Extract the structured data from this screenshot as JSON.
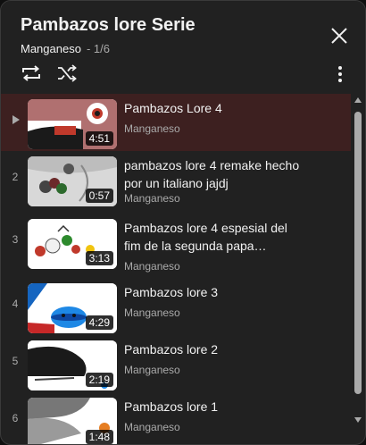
{
  "header": {
    "title": "Pambazos lore Serie",
    "channel": "Manganeso",
    "position": "- 1/6"
  },
  "icons": {
    "close": "close-icon",
    "loop": "loop-icon",
    "shuffle": "shuffle-icon",
    "menu": "more-vertical-icon",
    "now_playing": "play-indicator-icon"
  },
  "colors": {
    "panel_bg": "#212121",
    "active_row": "#3d2020",
    "text_primary": "#f1f1f1",
    "text_secondary": "#aaaaaa"
  },
  "playlist": {
    "items": [
      {
        "index": "",
        "playing": true,
        "title": "Pambazos Lore 4",
        "channel": "Manganeso",
        "duration": "4:51"
      },
      {
        "index": "2",
        "playing": false,
        "title": "pambazos lore 4 remake hecho por un italiano jajdj",
        "channel": "Manganeso",
        "duration": "0:57"
      },
      {
        "index": "3",
        "playing": false,
        "title": "Pambazos lore 4 espesial del fim de la segunda papa…",
        "channel": "Manganeso",
        "duration": "3:13"
      },
      {
        "index": "4",
        "playing": false,
        "title": "Pambazos lore 3",
        "channel": "Manganeso",
        "duration": "4:29"
      },
      {
        "index": "5",
        "playing": false,
        "title": "Pambazos lore 2",
        "channel": "Manganeso",
        "duration": "2:19"
      },
      {
        "index": "6",
        "playing": false,
        "title": "Pambazos lore 1",
        "channel": "Manganeso",
        "duration": "1:48"
      }
    ]
  }
}
